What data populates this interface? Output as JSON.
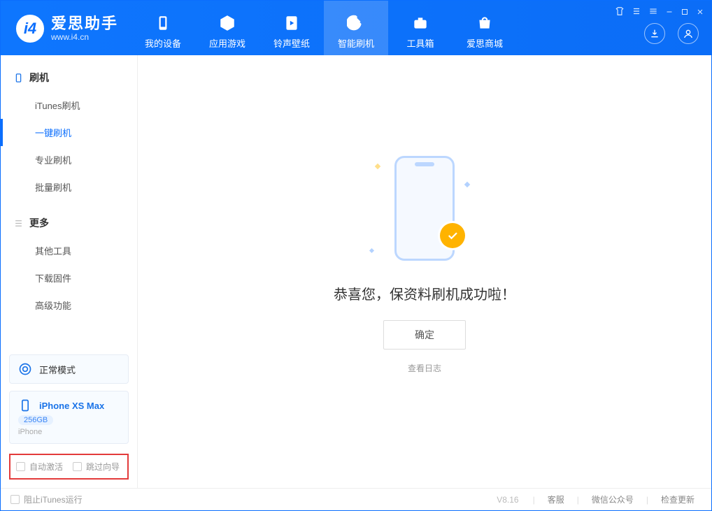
{
  "app": {
    "brand": "爱思助手",
    "site": "www.i4.cn"
  },
  "nav": {
    "items": [
      {
        "id": "my-device",
        "label": "我的设备"
      },
      {
        "id": "apps-games",
        "label": "应用游戏"
      },
      {
        "id": "ring-wall",
        "label": "铃声壁纸"
      },
      {
        "id": "smart-flash",
        "label": "智能刷机"
      },
      {
        "id": "toolbox",
        "label": "工具箱"
      },
      {
        "id": "store",
        "label": "爱思商城"
      }
    ]
  },
  "sidebar": {
    "section1_title": "刷机",
    "section1_items": [
      "iTunes刷机",
      "一键刷机",
      "专业刷机",
      "批量刷机"
    ],
    "section2_title": "更多",
    "section2_items": [
      "其他工具",
      "下载固件",
      "高级功能"
    ]
  },
  "mode_card": {
    "label": "正常模式"
  },
  "device_card": {
    "name": "iPhone XS Max",
    "storage": "256GB",
    "subtype": "iPhone"
  },
  "options": {
    "auto_activate": "自动激活",
    "skip_wizard": "跳过向导"
  },
  "main": {
    "success_text": "恭喜您，保资料刷机成功啦！",
    "ok_label": "确定",
    "view_log": "查看日志"
  },
  "footer": {
    "block_itunes": "阻止iTunes运行",
    "version": "V8.16",
    "links": [
      "客服",
      "微信公众号",
      "检查更新"
    ]
  }
}
